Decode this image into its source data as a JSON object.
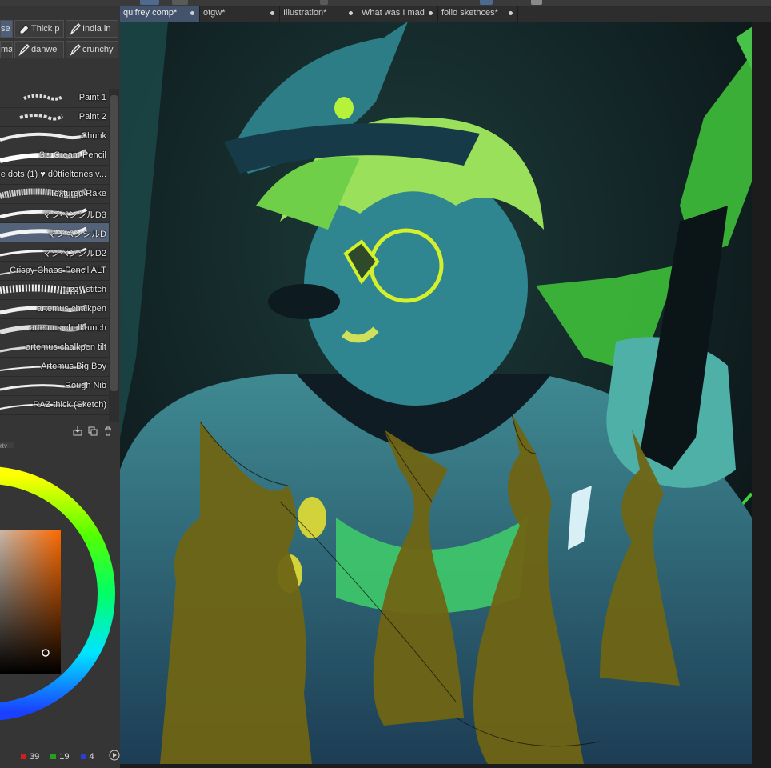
{
  "tool_buttons": {
    "row1": [
      {
        "label": "se",
        "selected": true
      },
      {
        "label": "Thick p",
        "icon": "eraser-icon"
      },
      {
        "label": "India in",
        "icon": "pen-icon"
      }
    ],
    "row2": [
      {
        "label": "mai"
      },
      {
        "label": "danwe",
        "icon": "pen-icon"
      },
      {
        "label": "crunchy",
        "icon": "pen-icon"
      }
    ]
  },
  "brushes": [
    {
      "label": "Paint 1"
    },
    {
      "label": "Paint 2"
    },
    {
      "label": "Chunk"
    },
    {
      "label": "SU Cream Pencil"
    },
    {
      "label": "e dots (1) ♥ d0ttieltones v..."
    },
    {
      "label": "Textured Rake"
    },
    {
      "label": "マジペンシルD3"
    },
    {
      "label": "マジペンシルD",
      "selected": true
    },
    {
      "label": "マジペンシルD2"
    },
    {
      "label": "Crispy Chaos Pencil ALT"
    },
    {
      "label": "fuzzy stitch"
    },
    {
      "label": "artemus chalkpen"
    },
    {
      "label": "artemus chalkrunch"
    },
    {
      "label": "artemus chalkpen tilt"
    },
    {
      "label": "Artemus Big Boy"
    },
    {
      "label": "Rough Nib"
    },
    {
      "label": "RAZ thick (Sketch)"
    }
  ],
  "property_tab": "rty",
  "color": {
    "r": "39",
    "g": "19",
    "b": "4",
    "r_color": "#cc1f1f",
    "g_color": "#1fa31f",
    "b_color": "#2a3fd1",
    "current": "#271304"
  },
  "tabs": [
    {
      "label": "quifrey comp*",
      "active": true
    },
    {
      "label": "otgw*"
    },
    {
      "label": "Illustration*"
    },
    {
      "label": "What was I mad"
    },
    {
      "label": "follo skethces*"
    }
  ],
  "icons": {
    "list_actions": [
      "import-icon",
      "duplicate-icon",
      "trash-icon"
    ],
    "color_mode": "play-circle-icon"
  }
}
